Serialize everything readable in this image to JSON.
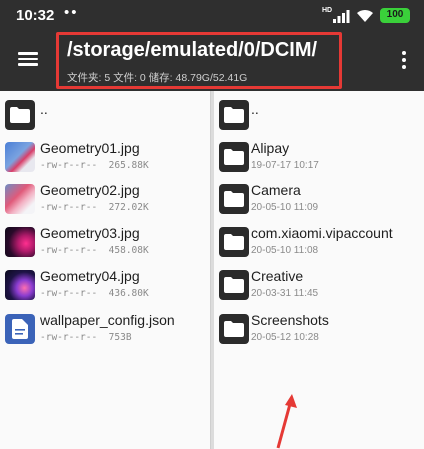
{
  "status_bar": {
    "time": "10:32",
    "notification_dots": "••",
    "network_type": "HD",
    "battery": "100"
  },
  "app_bar": {
    "path": "/storage/emulated/0/DCIM/",
    "stats": "文件夹: 5  文件: 0  储存: 48.79G/52.41G",
    "highlight_color": "#e53935"
  },
  "left_pane": {
    "parent_label": "..",
    "files": [
      {
        "name": "Geometry01.jpg",
        "perms": "-rw-r--r--",
        "size": "265.88K",
        "icon": "image-thumbnail"
      },
      {
        "name": "Geometry02.jpg",
        "perms": "-rw-r--r--",
        "size": "272.02K",
        "icon": "image-thumbnail"
      },
      {
        "name": "Geometry03.jpg",
        "perms": "-rw-r--r--",
        "size": "458.08K",
        "icon": "image-thumbnail"
      },
      {
        "name": "Geometry04.jpg",
        "perms": "-rw-r--r--",
        "size": "436.80K",
        "icon": "image-thumbnail"
      },
      {
        "name": "wallpaper_config.json",
        "perms": "-rw-r--r--",
        "size": "753B",
        "icon": "document-icon"
      }
    ]
  },
  "right_pane": {
    "parent_label": "..",
    "folders": [
      {
        "name": "Alipay",
        "date": "19-07-17 10:17"
      },
      {
        "name": "Camera",
        "date": "20-05-10 11:09"
      },
      {
        "name": "com.xiaomi.vipaccount",
        "date": "20-05-10 11:08"
      },
      {
        "name": "Creative",
        "date": "20-03-31 11:45"
      },
      {
        "name": "Screenshots",
        "date": "20-05-12 10:28"
      }
    ]
  }
}
